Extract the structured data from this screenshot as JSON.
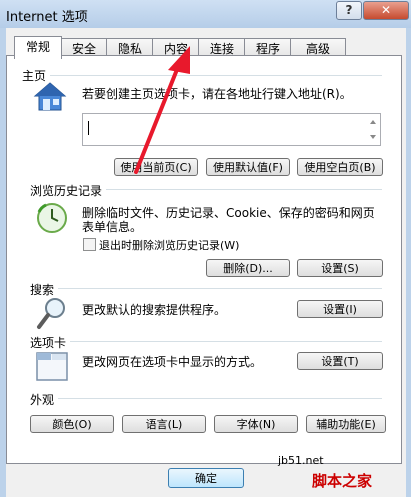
{
  "window": {
    "title": "Internet 选项",
    "help": "?",
    "close": "✕"
  },
  "tabs": [
    "常规",
    "安全",
    "隐私",
    "内容",
    "连接",
    "程序",
    "高级"
  ],
  "homepage": {
    "section": "主页",
    "desc": "若要创建主页选项卡，请在各地址行键入地址(R)。",
    "value": "",
    "buttons": [
      "使用当前页(C)",
      "使用默认值(F)",
      "使用空白页(B)"
    ]
  },
  "history": {
    "section": "浏览历史记录",
    "desc_line1": "删除临时文件、历史记录、Cookie、保存的密码和网页",
    "desc_line2": "表单信息。",
    "checkbox_label": "退出时删除浏览历史记录(W)",
    "checkbox_checked": false,
    "delete_button": "删除(D)...",
    "settings_button": "设置(S)"
  },
  "search": {
    "section": "搜索",
    "desc": "更改默认的搜索提供程序。",
    "settings_button": "设置(I)"
  },
  "tabs_section": {
    "section": "选项卡",
    "desc": "更改网页在选项卡中显示的方式。",
    "settings_button": "设置(T)"
  },
  "appearance": {
    "section": "外观",
    "buttons": [
      "颜色(O)",
      "语言(L)",
      "字体(N)",
      "辅助功能(E)"
    ]
  },
  "footer": {
    "ok": "确定"
  },
  "watermark": {
    "line1": "jb51.net",
    "line2": "脚本之家"
  },
  "colors": {
    "arrow": "#e8192c",
    "titlebar": "#bcd2ea",
    "close": "#c64b2f"
  }
}
